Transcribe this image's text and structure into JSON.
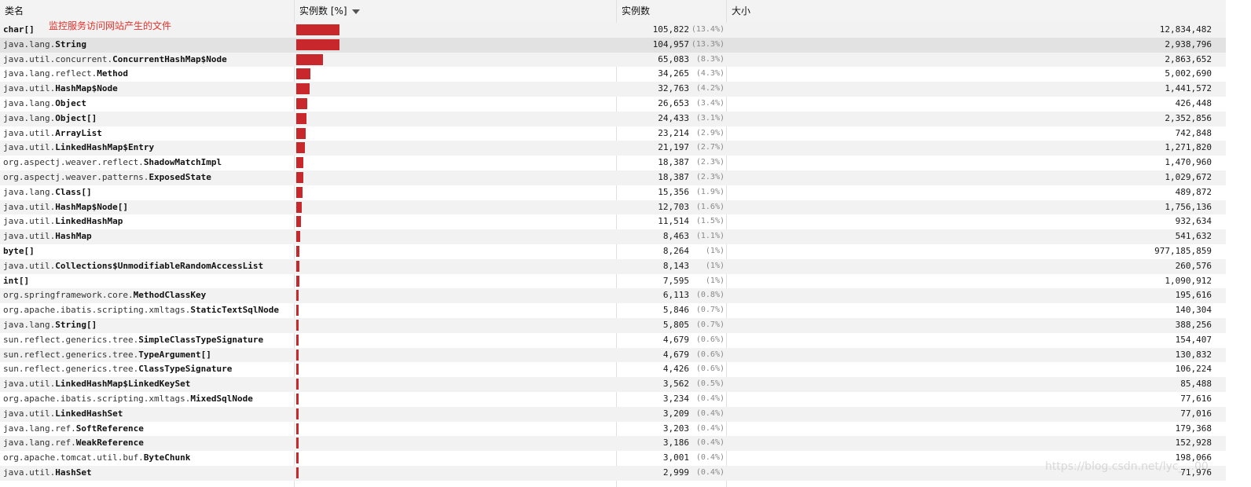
{
  "header": {
    "col_name": "类名",
    "col_bar": "实例数 [%]",
    "col_count": "实例数",
    "col_size": "大小"
  },
  "annotation": "监控服务访问网站产生的文件",
  "watermark": "https://blog.csdn.net/lyc_...00",
  "colors": {
    "bar": "#c8282c",
    "annotation": "#e8302a"
  },
  "rows": [
    {
      "pkg": "",
      "cls": "char[]",
      "count": "105,822",
      "pct_label": "(13.4%)",
      "pct": 13.4,
      "size": "12,834,482"
    },
    {
      "pkg": "java.lang.",
      "cls": "String",
      "count": "104,957",
      "pct_label": "(13.3%)",
      "pct": 13.3,
      "size": "2,938,796"
    },
    {
      "pkg": "java.util.concurrent.",
      "cls": "ConcurrentHashMap$Node",
      "count": "65,083",
      "pct_label": "(8.3%)",
      "pct": 8.3,
      "size": "2,863,652"
    },
    {
      "pkg": "java.lang.reflect.",
      "cls": "Method",
      "count": "34,265",
      "pct_label": "(4.3%)",
      "pct": 4.3,
      "size": "5,002,690"
    },
    {
      "pkg": "java.util.",
      "cls": "HashMap$Node",
      "count": "32,763",
      "pct_label": "(4.2%)",
      "pct": 4.2,
      "size": "1,441,572"
    },
    {
      "pkg": "java.lang.",
      "cls": "Object",
      "count": "26,653",
      "pct_label": "(3.4%)",
      "pct": 3.4,
      "size": "426,448"
    },
    {
      "pkg": "java.lang.",
      "cls": "Object[]",
      "count": "24,433",
      "pct_label": "(3.1%)",
      "pct": 3.1,
      "size": "2,352,856"
    },
    {
      "pkg": "java.util.",
      "cls": "ArrayList",
      "count": "23,214",
      "pct_label": "(2.9%)",
      "pct": 2.9,
      "size": "742,848"
    },
    {
      "pkg": "java.util.",
      "cls": "LinkedHashMap$Entry",
      "count": "21,197",
      "pct_label": "(2.7%)",
      "pct": 2.7,
      "size": "1,271,820"
    },
    {
      "pkg": "org.aspectj.weaver.reflect.",
      "cls": "ShadowMatchImpl",
      "count": "18,387",
      "pct_label": "(2.3%)",
      "pct": 2.3,
      "size": "1,470,960"
    },
    {
      "pkg": "org.aspectj.weaver.patterns.",
      "cls": "ExposedState",
      "count": "18,387",
      "pct_label": "(2.3%)",
      "pct": 2.3,
      "size": "1,029,672"
    },
    {
      "pkg": "java.lang.",
      "cls": "Class[]",
      "count": "15,356",
      "pct_label": "(1.9%)",
      "pct": 1.9,
      "size": "489,872"
    },
    {
      "pkg": "java.util.",
      "cls": "HashMap$Node[]",
      "count": "12,703",
      "pct_label": "(1.6%)",
      "pct": 1.6,
      "size": "1,756,136"
    },
    {
      "pkg": "java.util.",
      "cls": "LinkedHashMap",
      "count": "11,514",
      "pct_label": "(1.5%)",
      "pct": 1.5,
      "size": "932,634"
    },
    {
      "pkg": "java.util.",
      "cls": "HashMap",
      "count": "8,463",
      "pct_label": "(1.1%)",
      "pct": 1.1,
      "size": "541,632"
    },
    {
      "pkg": "",
      "cls": "byte[]",
      "count": "8,264",
      "pct_label": "(1%)",
      "pct": 1.0,
      "size": "977,185,859"
    },
    {
      "pkg": "java.util.",
      "cls": "Collections$UnmodifiableRandomAccessList",
      "count": "8,143",
      "pct_label": "(1%)",
      "pct": 1.0,
      "size": "260,576"
    },
    {
      "pkg": "",
      "cls": "int[]",
      "count": "7,595",
      "pct_label": "(1%)",
      "pct": 1.0,
      "size": "1,090,912"
    },
    {
      "pkg": "org.springframework.core.",
      "cls": "MethodClassKey",
      "count": "6,113",
      "pct_label": "(0.8%)",
      "pct": 0.8,
      "size": "195,616"
    },
    {
      "pkg": "org.apache.ibatis.scripting.xmltags.",
      "cls": "StaticTextSqlNode",
      "count": "5,846",
      "pct_label": "(0.7%)",
      "pct": 0.7,
      "size": "140,304"
    },
    {
      "pkg": "java.lang.",
      "cls": "String[]",
      "count": "5,805",
      "pct_label": "(0.7%)",
      "pct": 0.7,
      "size": "388,256"
    },
    {
      "pkg": "sun.reflect.generics.tree.",
      "cls": "SimpleClassTypeSignature",
      "count": "4,679",
      "pct_label": "(0.6%)",
      "pct": 0.6,
      "size": "154,407"
    },
    {
      "pkg": "sun.reflect.generics.tree.",
      "cls": "TypeArgument[]",
      "count": "4,679",
      "pct_label": "(0.6%)",
      "pct": 0.6,
      "size": "130,832"
    },
    {
      "pkg": "sun.reflect.generics.tree.",
      "cls": "ClassTypeSignature",
      "count": "4,426",
      "pct_label": "(0.6%)",
      "pct": 0.6,
      "size": "106,224"
    },
    {
      "pkg": "java.util.",
      "cls": "LinkedHashMap$LinkedKeySet",
      "count": "3,562",
      "pct_label": "(0.5%)",
      "pct": 0.5,
      "size": "85,488"
    },
    {
      "pkg": "org.apache.ibatis.scripting.xmltags.",
      "cls": "MixedSqlNode",
      "count": "3,234",
      "pct_label": "(0.4%)",
      "pct": 0.4,
      "size": "77,616"
    },
    {
      "pkg": "java.util.",
      "cls": "LinkedHashSet",
      "count": "3,209",
      "pct_label": "(0.4%)",
      "pct": 0.4,
      "size": "77,016"
    },
    {
      "pkg": "java.lang.ref.",
      "cls": "SoftReference",
      "count": "3,203",
      "pct_label": "(0.4%)",
      "pct": 0.4,
      "size": "179,368"
    },
    {
      "pkg": "java.lang.ref.",
      "cls": "WeakReference",
      "count": "3,186",
      "pct_label": "(0.4%)",
      "pct": 0.4,
      "size": "152,928"
    },
    {
      "pkg": "org.apache.tomcat.util.buf.",
      "cls": "ByteChunk",
      "count": "3,001",
      "pct_label": "(0.4%)",
      "pct": 0.4,
      "size": "198,066"
    },
    {
      "pkg": "java.util.",
      "cls": "HashSet",
      "count": "2,999",
      "pct_label": "(0.4%)",
      "pct": 0.4,
      "size": "71,976"
    }
  ]
}
